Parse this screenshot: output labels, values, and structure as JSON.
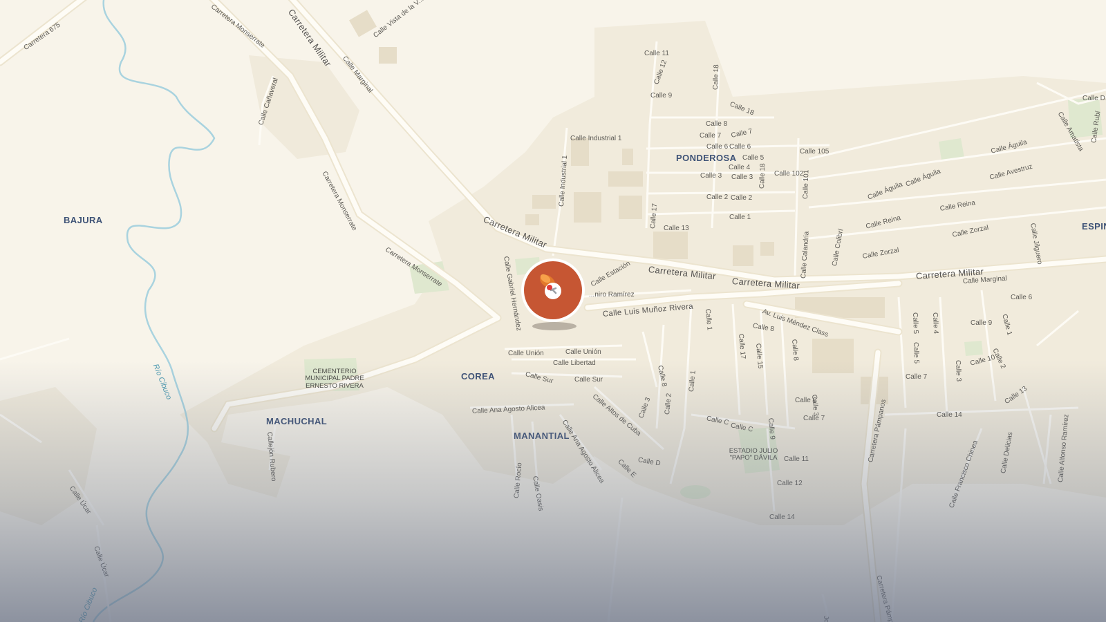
{
  "map": {
    "colors": {
      "land": "#f8f4ea",
      "road": "#fdfbf5",
      "road_casing": "#e8e0cc",
      "building": "#ece4d2",
      "park": "#dfe8cf",
      "river": "#a9d3df",
      "pin": "#c65633",
      "pin_ring": "#ffffff"
    },
    "neighborhoods": {
      "bajura": "BAJURA",
      "ponderosa": "PONDEROSA",
      "corea": "COREA",
      "machuchal": "MACHUCHAL",
      "manantial": "MANANTIAL",
      "espin": "ESPIN"
    },
    "pois": {
      "cementerio": "CEMENTERIO MUNICIPAL PADRE ERNESTO RIVERA",
      "estadio": "ESTADIO JULIO \"PAPO\" DÁVILA"
    },
    "water": {
      "rio_cibuco": "Río Cibuco",
      "rio_cibuco_2": "Río Cibuco"
    },
    "roads": {
      "carretera_675": "Carretera 675",
      "monserrate_1": "Carretera Monserrate",
      "monserrate_2": "Carretera Monserrate",
      "monserrate_3": "Carretera Monserrate",
      "militar_1": "Carretera Militar",
      "militar_2": "Carretera Militar",
      "militar_3": "Carretera Militar",
      "militar_4": "Carretera Militar",
      "militar_5": "Carretera Militar",
      "vista": "Calle Vista de la V...",
      "marginal_1": "Calle Marginal",
      "marginal_2": "Calle Marginal",
      "canaveral": "Calle Cañaveral",
      "industrial_1": "Calle Industrial 1",
      "industrial_1v": "Calle Industrial 1",
      "gabriel": "Calle Gabriel Hernández",
      "estacion": "Calle Estación",
      "ramirez": "...niro Ramírez",
      "munoz": "Calle Luis Muñoz Rivera",
      "mendez": "Av. Luis Méndez Class",
      "union_1": "Calle Unión",
      "union_2": "Calle Unión",
      "libertad": "Calle Libertad",
      "sur_1": "Calle Sur",
      "sur_2": "Calle Sur",
      "altos": "Calle Altos de Cuba",
      "ana_1": "Calle Ana Agosto Alicea",
      "ana_2": "Calle Ana Agosto Alicea",
      "rocio": "Calle Rocío",
      "oasis": "Calle Oasis",
      "callejon": "Callejón Rubero",
      "ucar_1": "Calle Úcar",
      "ucar_2": "Calle Úcar",
      "c11": "Calle 11",
      "c12": "Calle 12",
      "c9": "Calle 9",
      "c18": "Calle 18",
      "c18b": "Calle 18",
      "c8": "Calle 8",
      "c7": "Calle 7",
      "c7b": "Calle 7",
      "c6": "Calle 6",
      "c6b": "Calle 6",
      "c5": "Calle 5",
      "c4": "Calle 4",
      "c3": "Calle 3",
      "c3b": "Calle 3",
      "c2": "Calle 2",
      "c2b": "Calle 2",
      "c1": "Calle 1",
      "c13": "Calle 13",
      "c17": "Calle 17",
      "c18c": "Calle 18",
      "c105": "Calle 105",
      "c102": "Calle 102",
      "c101": "Calle 101",
      "calandria": "Calle Calandria",
      "colibri": "Calle Colibrí",
      "aguila_1": "Calle Águila",
      "aguila_2": "Calle Águila",
      "aguila_3": "Calle Águila",
      "avestruz": "Calle Avestruz",
      "reina_1": "Calle Reina",
      "reina_2": "Calle Reina",
      "zorzal_1": "Calle Zorzal",
      "zorzal_2": "Calle Zorzal",
      "jilguero": "Calle Jilguero",
      "amatista": "Calle Amatista",
      "rubi": "Calle Rubí",
      "calle_d_top": "Calle D...",
      "c6_east": "Calle 6",
      "c1_mid": "Calle 1",
      "c8_mid": "Calle 8",
      "c17_mid": "Calle 17",
      "c15": "Calle 15",
      "c8_v": "Calle 8",
      "c5_a": "Calle 5",
      "c5_b": "Calle 5",
      "c4_v": "Calle 4",
      "c9_e": "Calle 9",
      "c1_e": "Calle 1",
      "c10": "Calle 10",
      "c2_e": "Calle 2",
      "c3_e": "Calle 3",
      "c7_e": "Calle 7",
      "c13_e": "Calle 13",
      "c14_e": "Calle 14",
      "c6_s": "Calle 6",
      "c3_s": "Calle 3",
      "c7_s": "Calle 7",
      "c8_w": "Calle 8",
      "c1_w": "Calle 1",
      "c2_w": "Calle 2",
      "c3_w": "Calle 3",
      "calle_c_1": "Calle C",
      "calle_c_2": "Calle C",
      "calle_d": "Calle D",
      "calle_e": "Calle E",
      "c9_s": "Calle 9",
      "c11_s": "Calle 11",
      "c12_s": "Calle 12",
      "c14_s": "Calle 14",
      "pampanos_1": "Carretera Pámpanos",
      "pampanos_2": "Carretera Pámpanos",
      "chinea": "Calle Francisco Chinea",
      "delicias": "Calle Delicias",
      "alfonso": "Calle Alfonso Ramírez",
      "jose": "José..."
    }
  }
}
